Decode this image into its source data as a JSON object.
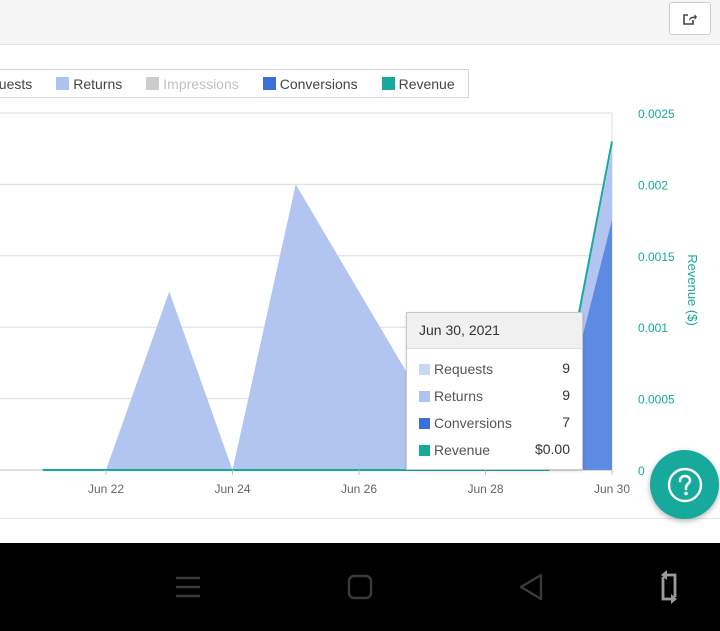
{
  "legend": {
    "items": [
      {
        "label": "quests",
        "color": "#c9d6f4",
        "active": true
      },
      {
        "label": "Returns",
        "color": "#adc2ef",
        "active": true
      },
      {
        "label": "Impressions",
        "color": "#cccccc",
        "active": false
      },
      {
        "label": "Conversions",
        "color": "#3e6fd9",
        "active": true
      },
      {
        "label": "Revenue",
        "color": "#16a99c",
        "active": true
      }
    ]
  },
  "axis": {
    "right_title": "Revenue ($)",
    "right_ticks": [
      "0",
      "0.0005",
      "0.001",
      "0.0015",
      "0.002",
      "0.0025"
    ],
    "x_ticks": [
      "Jun 22",
      "Jun 24",
      "Jun 26",
      "Jun 28",
      "Jun 30"
    ]
  },
  "tooltip": {
    "date": "Jun 30, 2021",
    "rows": [
      {
        "label": "Requests",
        "value": "9",
        "color": "#c9d6f4"
      },
      {
        "label": "Returns",
        "value": "9",
        "color": "#adc2ef"
      },
      {
        "label": "Conversions",
        "value": "7",
        "color": "#3e6fd9"
      },
      {
        "label": "Revenue",
        "value": "$0.00",
        "color": "#16a99c"
      }
    ]
  },
  "chart_data": {
    "type": "area",
    "x": [
      "Jun 21",
      "Jun 22",
      "Jun 23",
      "Jun 24",
      "Jun 25",
      "Jun 26",
      "Jun 27",
      "Jun 28",
      "Jun 29",
      "Jun 30"
    ],
    "series": [
      {
        "name": "Returns",
        "values": [
          0,
          0,
          5,
          0,
          8,
          5,
          2,
          0,
          0,
          9
        ]
      },
      {
        "name": "Conversions",
        "values": [
          0,
          0,
          0,
          0,
          0,
          0,
          0,
          0,
          0,
          7
        ]
      },
      {
        "name": "Revenue",
        "values": [
          0,
          0,
          0,
          0,
          0,
          0,
          0,
          0,
          0,
          0.0023
        ]
      }
    ],
    "left_ylim": [
      0,
      10
    ],
    "right_ylim": [
      0,
      0.0025
    ],
    "ylabel_right": "Revenue ($)",
    "grid": true
  },
  "nav": {
    "menu": "menu-icon",
    "home": "home-icon",
    "back": "back-icon",
    "rotate": "rotate-icon"
  }
}
